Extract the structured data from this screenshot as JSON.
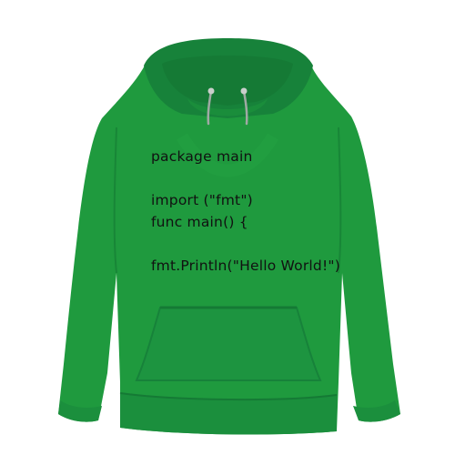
{
  "product": {
    "garment": "hoodie",
    "colors": {
      "fabric": "#1f9a3e",
      "fabric_shadow": "#17823a",
      "fabric_highlight": "#27ac49",
      "ink": "#111111",
      "background": "#ffffff"
    },
    "print_lines": [
      "package main",
      "",
      "import (\"fmt\")",
      "func main() {",
      "",
      "fmt.Println(\"Hello World!\")"
    ]
  }
}
